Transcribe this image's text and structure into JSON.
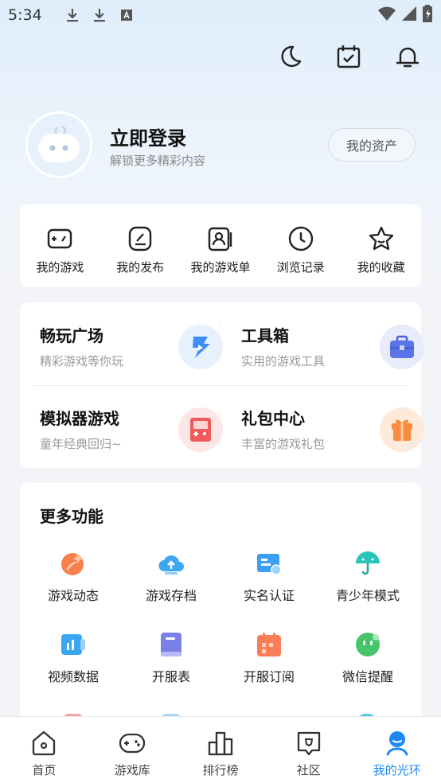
{
  "status_bar": {
    "time": "5:34"
  },
  "profile": {
    "login_title": "立即登录",
    "login_subtitle": "解锁更多精彩内容",
    "assets_button": "我的资产"
  },
  "quick_actions": [
    {
      "label": "我的游戏",
      "icon": "gamepad-icon"
    },
    {
      "label": "我的发布",
      "icon": "edit-icon"
    },
    {
      "label": "我的游戏单",
      "icon": "game-list-icon"
    },
    {
      "label": "浏览记录",
      "icon": "clock-icon"
    },
    {
      "label": "我的收藏",
      "icon": "star-icon"
    }
  ],
  "features": [
    {
      "title": "畅玩广场",
      "subtitle": "精彩游戏等你玩",
      "icon": "lightning-play-icon",
      "color": "#3b8ff5"
    },
    {
      "title": "工具箱",
      "subtitle": "实用的游戏工具",
      "icon": "toolbox-icon",
      "color": "#5b74e8"
    },
    {
      "title": "模拟器游戏",
      "subtitle": "童年经典回归~",
      "icon": "emulator-icon",
      "color": "#ef5a5a"
    },
    {
      "title": "礼包中心",
      "subtitle": "丰富的游戏礼包",
      "icon": "gift-icon",
      "color": "#fb8b3e"
    }
  ],
  "more_functions": {
    "title": "更多功能",
    "items": [
      {
        "label": "游戏动态",
        "icon": "game-news-icon",
        "color": "#f8804a"
      },
      {
        "label": "游戏存档",
        "icon": "cloud-upload-icon",
        "color": "#3aa7ef"
      },
      {
        "label": "实名认证",
        "icon": "id-card-icon",
        "color": "#3aa0f5"
      },
      {
        "label": "青少年模式",
        "icon": "umbrella-icon",
        "color": "#26c6b8"
      },
      {
        "label": "视频数据",
        "icon": "video-data-icon",
        "color": "#38a6f0"
      },
      {
        "label": "开服表",
        "icon": "server-table-icon",
        "color": "#7b7fe8"
      },
      {
        "label": "开服订阅",
        "icon": "calendar-subscribe-icon",
        "color": "#fb7e56"
      },
      {
        "label": "微信提醒",
        "icon": "wechat-icon",
        "color": "#46c46a"
      }
    ]
  },
  "tabs": [
    {
      "label": "首页",
      "icon": "home-icon",
      "active": false
    },
    {
      "label": "游戏库",
      "icon": "game-library-icon",
      "active": false
    },
    {
      "label": "排行榜",
      "icon": "ranking-icon",
      "active": false
    },
    {
      "label": "社区",
      "icon": "community-icon",
      "active": false
    },
    {
      "label": "我的光环",
      "icon": "profile-icon",
      "active": true
    }
  ],
  "colors": {
    "accent": "#1e88f5"
  }
}
